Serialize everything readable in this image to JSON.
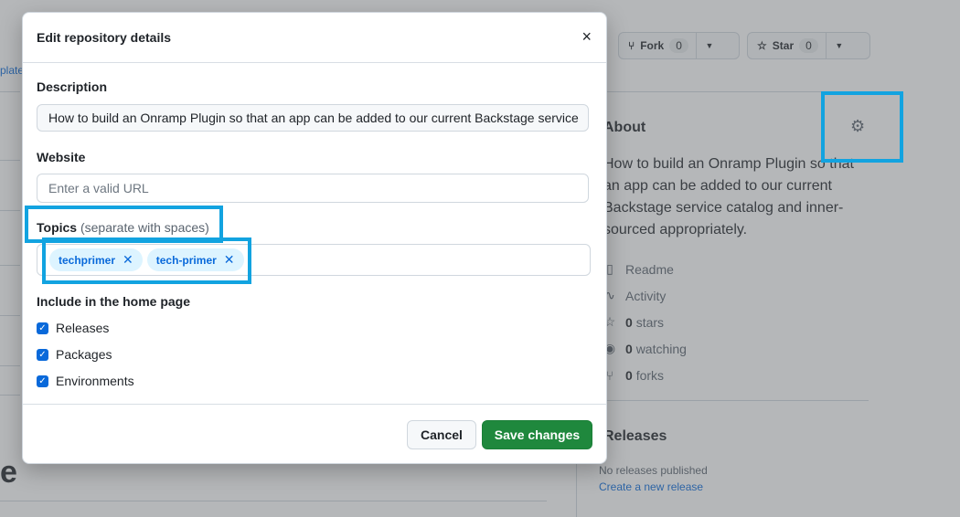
{
  "background": {
    "left_edge_text": "plate",
    "big_heading_fragment": "e",
    "fork": {
      "label": "Fork",
      "count": "0",
      "icon": "fork-icon"
    },
    "star": {
      "label": "Star",
      "count": "0",
      "icon": "star-icon"
    },
    "about": {
      "title": "About",
      "description": "How to build an Onramp Plugin so that an app can be added to our current Backstage service catalog and inner-sourced appropriately.",
      "items": [
        {
          "icon": "book-icon",
          "count": "",
          "label": "Readme"
        },
        {
          "icon": "pulse-icon",
          "count": "",
          "label": "Activity"
        },
        {
          "icon": "star-icon",
          "count": "0",
          "label": "stars"
        },
        {
          "icon": "eye-icon",
          "count": "0",
          "label": "watching"
        },
        {
          "icon": "fork-icon",
          "count": "0",
          "label": "forks"
        }
      ]
    },
    "releases": {
      "title": "Releases",
      "none_text": "No releases published",
      "create_link": "Create a new release"
    }
  },
  "modal": {
    "title": "Edit repository details",
    "close_glyph": "×",
    "description_label": "Description",
    "description_value": "How to build an Onramp Plugin so that an app can be added to our current Backstage service",
    "website_label": "Website",
    "website_placeholder": "Enter a valid URL",
    "topics_label": "Topics",
    "topics_hint": "(separate with spaces)",
    "topics": [
      "techprimer",
      "tech-primer"
    ],
    "include_label": "Include in the home page",
    "checkboxes": [
      {
        "label": "Releases",
        "checked": true
      },
      {
        "label": "Packages",
        "checked": true
      },
      {
        "label": "Environments",
        "checked": true
      }
    ],
    "cancel_label": "Cancel",
    "save_label": "Save changes"
  },
  "colors": {
    "accent": "#0969da",
    "save_green": "#1f883d",
    "highlight": "#12a3e0"
  }
}
